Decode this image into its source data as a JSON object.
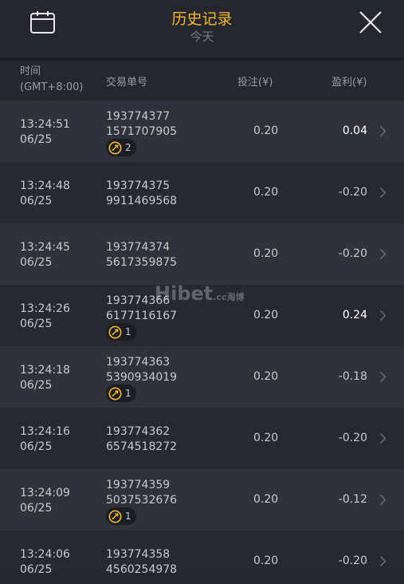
{
  "header": {
    "title": "历史记录",
    "subtitle": "今天"
  },
  "columns": {
    "time": "时间",
    "timezone": "(GMT+8:00)",
    "order": "交易单号",
    "bet": "投注(¥)",
    "profit": "盈利(¥)"
  },
  "rows": [
    {
      "time": "13:24:51",
      "date": "06/25",
      "order1": "193774377",
      "order2": "1571707905",
      "badge": "2",
      "bet": "0.20",
      "profit": "0.04",
      "positive": true
    },
    {
      "time": "13:24:48",
      "date": "06/25",
      "order1": "193774375",
      "order2": "9911469568",
      "badge": "",
      "bet": "0.20",
      "profit": "-0.20",
      "positive": false
    },
    {
      "time": "13:24:45",
      "date": "06/25",
      "order1": "193774374",
      "order2": "5617359875",
      "badge": "",
      "bet": "0.20",
      "profit": "-0.20",
      "positive": false
    },
    {
      "time": "13:24:26",
      "date": "06/25",
      "order1": "193774366",
      "order2": "6177116167",
      "badge": "1",
      "bet": "0.20",
      "profit": "0.24",
      "positive": true
    },
    {
      "time": "13:24:18",
      "date": "06/25",
      "order1": "193774363",
      "order2": "5390934019",
      "badge": "1",
      "bet": "0.20",
      "profit": "-0.18",
      "positive": false
    },
    {
      "time": "13:24:16",
      "date": "06/25",
      "order1": "193774362",
      "order2": "6574518272",
      "badge": "",
      "bet": "0.20",
      "profit": "-0.20",
      "positive": false
    },
    {
      "time": "13:24:09",
      "date": "06/25",
      "order1": "193774359",
      "order2": "5037532676",
      "badge": "1",
      "bet": "0.20",
      "profit": "-0.12",
      "positive": false
    },
    {
      "time": "13:24:06",
      "date": "06/25",
      "order1": "193774358",
      "order2": "4560254978",
      "badge": "",
      "bet": "0.20",
      "profit": "-0.20",
      "positive": false
    }
  ],
  "watermark": {
    "main": "Hibet",
    "suffix": ".cc",
    "cn": "海博"
  },
  "colors": {
    "accent": "#f6b830",
    "background": "#25262e",
    "row_odd": "#30313a",
    "row_even": "#282930"
  },
  "icons": {
    "left": "calendar-icon",
    "right": "close-icon",
    "badge": "free-spin-coin-icon",
    "row_action": "chevron-right-icon"
  }
}
